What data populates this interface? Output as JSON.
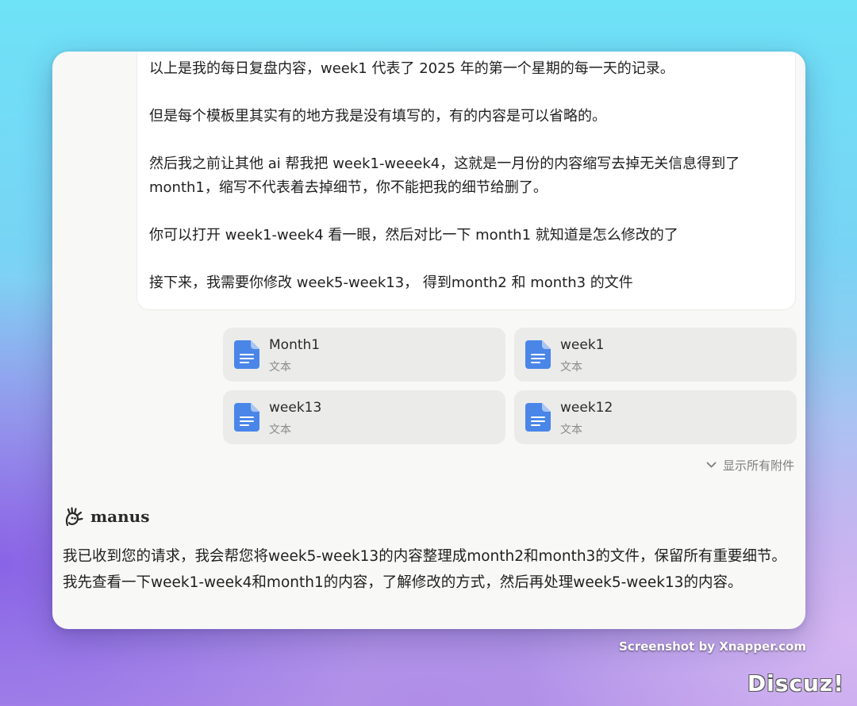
{
  "user_message": {
    "paragraphs": [
      "以上是我的每日复盘内容，week1 代表了 2025 年的第一个星期的每一天的记录。",
      "但是每个模板里其实有的地方我是没有填写的，有的内容是可以省略的。",
      "然后我之前让其他 ai 帮我把 week1-weeek4，这就是一月份的内容缩写去掉无关信息得到了 month1，缩写不代表着去掉细节，你不能把我的细节给删了。",
      "你可以打开 week1-week4 看一眼，然后对比一下 month1 就知道是怎么修改的了",
      "接下来，我需要你修改 week5-week13， 得到month2 和 month3 的文件"
    ]
  },
  "attachments": [
    {
      "name": "Month1",
      "type": "文本"
    },
    {
      "name": "week1",
      "type": "文本"
    },
    {
      "name": "week13",
      "type": "文本"
    },
    {
      "name": "week12",
      "type": "文本"
    }
  ],
  "show_all_label": "显示所有附件",
  "agent": {
    "name": "manus",
    "reply": "我已收到您的请求，我会帮您将week5-week13的内容整理成month2和month3的文件，保留所有重要细节。我先查看一下week1-week4和month1的内容，了解修改的方式，然后再处理week5-week13的内容。"
  },
  "watermark": "Screenshot by Xnapper.com",
  "site_mark": "Discuz!",
  "colors": {
    "doc_icon": "#4a86e8",
    "card_bg": "#ebebea",
    "window_bg": "#f8f8f7"
  }
}
